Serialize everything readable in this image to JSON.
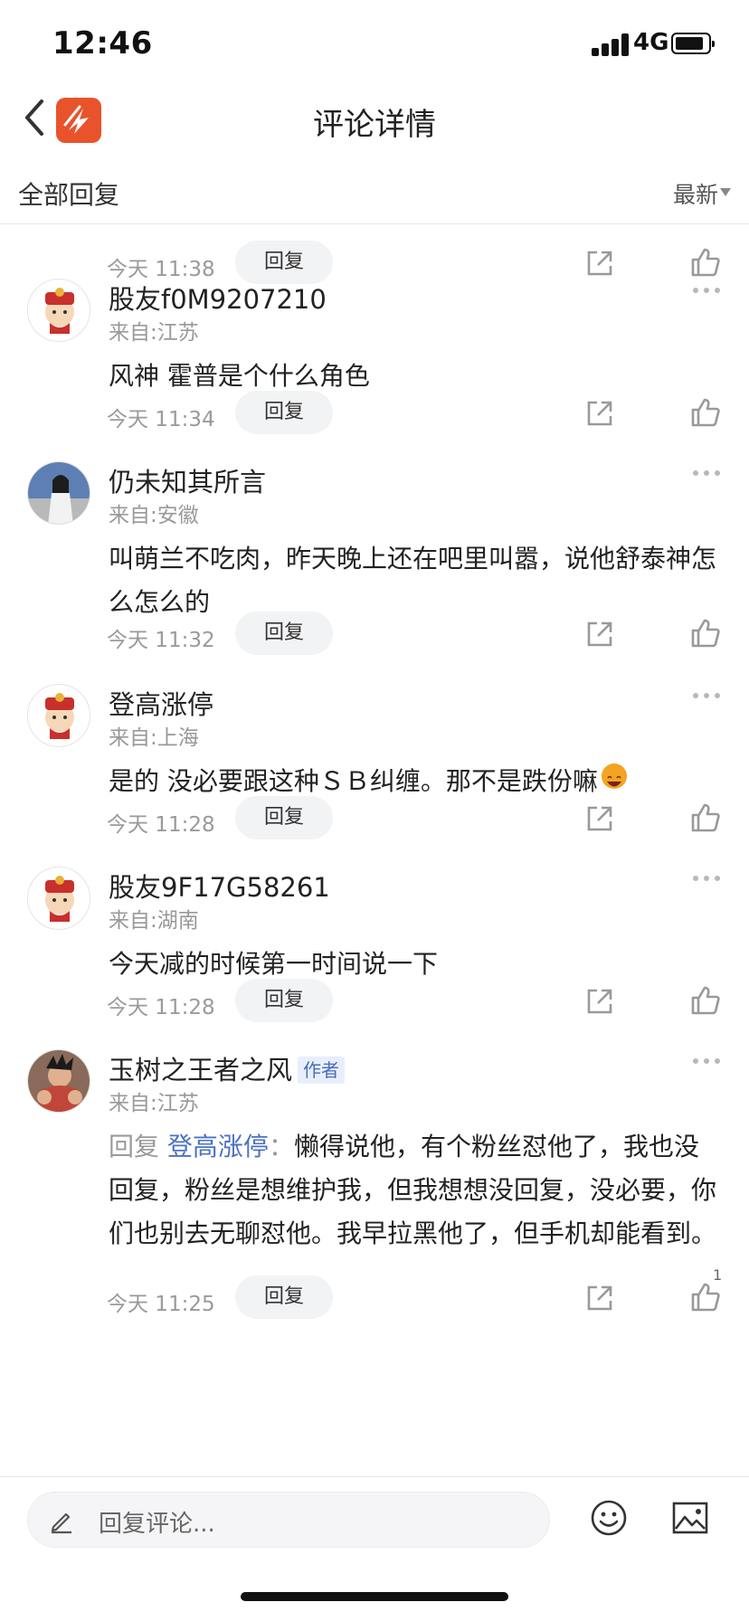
{
  "status_bar": {
    "time": "12:46",
    "network": "4G"
  },
  "nav": {
    "title": "评论详情"
  },
  "filter": {
    "left_label": "全部回复",
    "sort_label": "最新"
  },
  "first_actions": {
    "time": "今天 11:38",
    "reply_label": "回复"
  },
  "comments": [
    {
      "user": "股友f0M9207210",
      "location": "来自:江苏",
      "text": "风神 霍普是个什么角色",
      "time": "今天 11:34",
      "reply_label": "回复"
    },
    {
      "user": "仍未知其所言",
      "location": "来自:安徽",
      "text": "叫萌兰不吃肉，昨天晚上还在吧里叫嚣，说他舒泰神怎么怎么的",
      "time": "今天 11:32",
      "reply_label": "回复"
    },
    {
      "user": "登高涨停",
      "location": "来自:上海",
      "text": "是的 没必要跟这种ＳＢ纠缠。那不是跌份嘛",
      "time": "今天 11:28",
      "reply_label": "回复"
    },
    {
      "user": "股友9F17G58261",
      "location": "来自:湖南",
      "text": "今天减的时候第一时间说一下",
      "time": "今天 11:28",
      "reply_label": "回复"
    },
    {
      "user": "玉树之王者之风",
      "badge": "作者",
      "location": "来自:江苏",
      "reply_prefix": "回复",
      "reply_target": "登高涨停",
      "reply_sep": "：",
      "text": "懒得说他，有个粉丝怼他了，我也没回复，粉丝是想维护我，但我想想没回复，没必要，你们也别去无聊怼他。我早拉黑他了，但手机却能看到。",
      "time": "今天 11:25",
      "reply_label": "回复",
      "like_count": "1"
    }
  ],
  "bottom": {
    "placeholder": "回复评论..."
  },
  "colors": {
    "accent": "#4a72c4",
    "logo": "#e8532b",
    "muted": "#9a9a9a"
  }
}
